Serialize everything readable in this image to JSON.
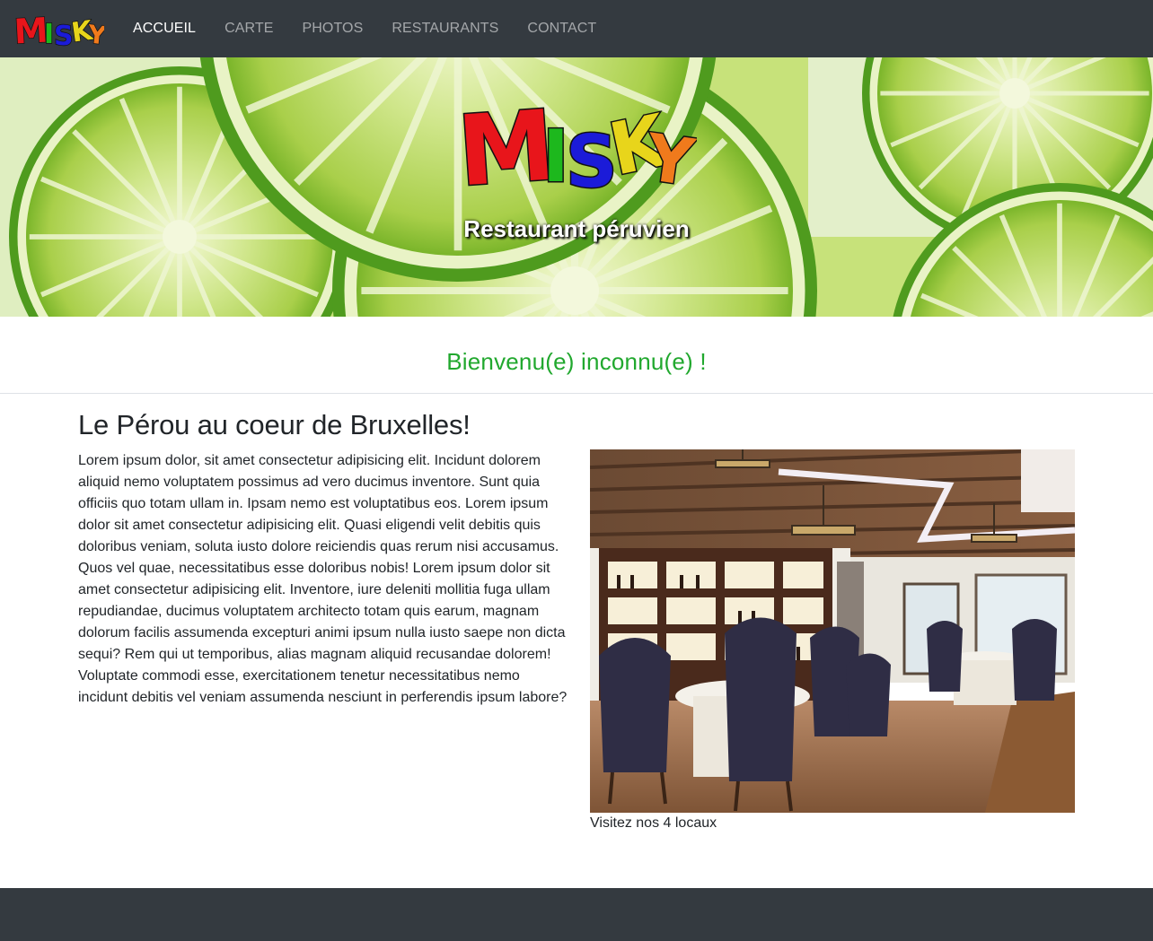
{
  "navbar": {
    "brand_logo_text": "MISKY",
    "items": [
      {
        "label": "ACCUEIL",
        "active": true
      },
      {
        "label": "CARTE",
        "active": false
      },
      {
        "label": "PHOTOS",
        "active": false
      },
      {
        "label": "RESTAURANTS",
        "active": false
      },
      {
        "label": "CONTACT",
        "active": false
      }
    ]
  },
  "hero": {
    "logo_text": "MISKY",
    "subtitle": "Restaurant péruvien"
  },
  "welcome": {
    "message": "Bienvenu(e) inconnu(e) !"
  },
  "main": {
    "title": "Le Pérou au coeur de Bruxelles!",
    "paragraph": "Lorem ipsum dolor, sit amet consectetur adipisicing elit. Incidunt dolorem aliquid nemo voluptatem possimus ad vero ducimus inventore. Sunt quia officiis quo totam ullam in. Ipsam nemo est voluptatibus eos. Lorem ipsum dolor sit amet consectetur adipisicing elit. Quasi eligendi velit debitis quis doloribus veniam, soluta iusto dolore reiciendis quas rerum nisi accusamus. Quos vel quae, necessitatibus esse doloribus nobis! Lorem ipsum dolor sit amet consectetur adipisicing elit. Inventore, iure deleniti mollitia fuga ullam repudiandae, ducimus voluptatem architecto totam quis earum, magnam dolorum facilis assumenda excepturi animi ipsum nulla iusto saepe non dicta sequi? Rem qui ut temporibus, alias magnam aliquid recusandae dolorem! Voluptate commodi esse, exercitationem tenetur necessitatibus nemo incidunt debitis vel veniam assumenda nesciunt in perferendis ipsum labore?",
    "image_caption": "Visitez nos 4 locaux"
  },
  "colors": {
    "navbar_bg": "#343a40",
    "welcome_green": "#21a82e",
    "logo_letters": [
      "#e8151b",
      "#1db81d",
      "#1b1bd8",
      "#e8d51b",
      "#f07a1c"
    ]
  }
}
